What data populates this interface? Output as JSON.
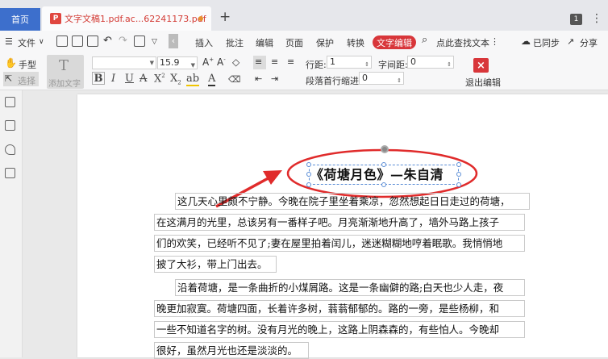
{
  "tabs": {
    "home_label": "首页",
    "doc_title": "文字文稿1.pdf.ac...62241173.pdf",
    "add_label": "+",
    "window_count": "1",
    "menu_glyph": "⋮"
  },
  "menu": {
    "file_label": "文件",
    "items": [
      "插入",
      "批注",
      "编辑",
      "页面",
      "保护",
      "转换",
      "文字编辑"
    ],
    "active": "文字编辑",
    "search_label": "点此查找文本",
    "sync_label": "已同步",
    "share_label": "分享"
  },
  "toolbar": {
    "hand_label": "手型",
    "select_label": "选择",
    "add_text_label": "添加文字",
    "font_size": "15.9",
    "line_spacing_label": "行距:",
    "line_spacing_value": "1",
    "char_spacing_label": "字间距:",
    "char_spacing_value": "0",
    "indent_label": "段落首行缩进:",
    "indent_value": "0",
    "exit_label": "退出编辑"
  },
  "document": {
    "title": "《荷塘月色》—朱自清",
    "paragraph1": [
      "这几天心里颇不宁静。今晚在院子里坐着乘凉，忽然想起日日走过的荷塘，",
      "在这满月的光里，总该另有一番样子吧。月亮渐渐地升高了，墙外马路上孩子",
      "们的欢笑，已经听不见了;妻在屋里拍着闰儿，迷迷糊糊地哼着眠歌。我悄悄地",
      "披了大衫，带上门出去。"
    ],
    "paragraph2": [
      "沿着荷塘，是一条曲折的小煤屑路。这是一条幽僻的路;白天也少人走，夜",
      "晚更加寂寞。荷塘四面，长着许多树，蓊蓊郁郁的。路的一旁，是些杨柳，和",
      "一些不知道名字的树。没有月光的晚上，这路上阴森森的，有些怕人。今晚却",
      "很好，虽然月光也还是淡淡的。"
    ]
  },
  "colors": {
    "accent_red": "#d8363a",
    "tab_blue": "#3d6fcc",
    "selection_blue": "#5c8ed6"
  }
}
